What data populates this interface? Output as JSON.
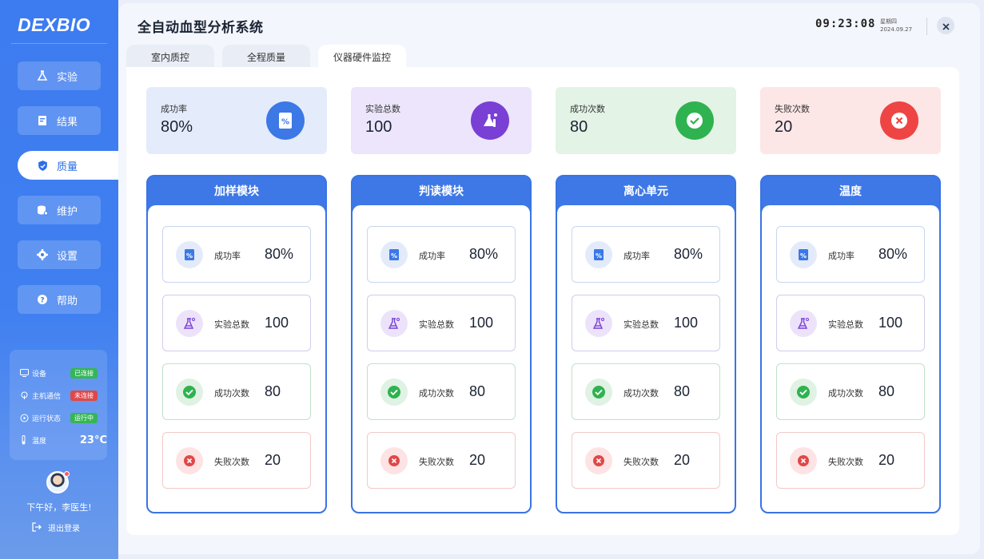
{
  "brand": "DEXBIO",
  "app_title": "全自动血型分析系统",
  "clock": {
    "time": "09:23:08",
    "weekday": "星期四",
    "date": "2024.09.27"
  },
  "nav": [
    {
      "label": "实验",
      "icon": "flask-icon"
    },
    {
      "label": "结果",
      "icon": "document-icon"
    },
    {
      "label": "质量",
      "icon": "shield-icon",
      "active": true
    },
    {
      "label": "维护",
      "icon": "database-icon"
    },
    {
      "label": "设置",
      "icon": "gear-icon"
    },
    {
      "label": "帮助",
      "icon": "help-icon"
    }
  ],
  "status": [
    {
      "label": "设备",
      "badge": "已连接",
      "badge_color": "#35b656",
      "icon": "monitor-icon"
    },
    {
      "label": "主机通信",
      "badge": "未连接",
      "badge_color": "#e04848",
      "icon": "antenna-icon"
    },
    {
      "label": "运行状态",
      "badge": "运行中",
      "badge_color": "#35b656",
      "icon": "running-icon"
    },
    {
      "label": "温度",
      "value": "23°C",
      "icon": "thermometer-icon"
    }
  ],
  "user": {
    "greeting": "下午好，李医生!",
    "logout": "退出登录"
  },
  "tabs": [
    {
      "label": "室内质控"
    },
    {
      "label": "全程质量"
    },
    {
      "label": "仪器硬件监控",
      "active": true
    }
  ],
  "summary": [
    {
      "label": "成功率",
      "value": "80%",
      "bg": "#e4ecfb",
      "icon_bg": "#3c78e6",
      "icon": "percent-icon"
    },
    {
      "label": "实验总数",
      "value": "100",
      "bg": "#ece5fb",
      "icon_bg": "#7a3fd4",
      "icon": "flask-icon"
    },
    {
      "label": "成功次数",
      "value": "80",
      "bg": "#e3f3e6",
      "icon_bg": "#2fb250",
      "icon": "check-icon"
    },
    {
      "label": "失败次数",
      "value": "20",
      "bg": "#fde6e6",
      "icon_bg": "#ef4444",
      "icon": "x-icon"
    }
  ],
  "modules": [
    {
      "title": "加样模块",
      "metrics": [
        {
          "label": "成功率",
          "value": "80%"
        },
        {
          "label": "实验总数",
          "value": "100"
        },
        {
          "label": "成功次数",
          "value": "80"
        },
        {
          "label": "失败次数",
          "value": "20"
        }
      ]
    },
    {
      "title": "判读模块",
      "metrics": [
        {
          "label": "成功率",
          "value": "80%"
        },
        {
          "label": "实验总数",
          "value": "100"
        },
        {
          "label": "成功次数",
          "value": "80"
        },
        {
          "label": "失败次数",
          "value": "20"
        }
      ]
    },
    {
      "title": "离心单元",
      "metrics": [
        {
          "label": "成功率",
          "value": "80%"
        },
        {
          "label": "实验总数",
          "value": "100"
        },
        {
          "label": "成功次数",
          "value": "80"
        },
        {
          "label": "失败次数",
          "value": "20"
        }
      ]
    },
    {
      "title": "温度",
      "metrics": [
        {
          "label": "成功率",
          "value": "80%"
        },
        {
          "label": "实验总数",
          "value": "100"
        },
        {
          "label": "成功次数",
          "value": "80"
        },
        {
          "label": "失败次数",
          "value": "20"
        }
      ]
    }
  ],
  "metric_styles": [
    {
      "icon": "percent-icon",
      "icon_bg": "#e3ebfb",
      "border": "#c9d6ee"
    },
    {
      "icon": "flask-icon",
      "icon_bg": "#ece3fb",
      "border": "#d4cbea"
    },
    {
      "icon": "check-icon",
      "icon_bg": "#dff2e3",
      "border": "#bfe2c6"
    },
    {
      "icon": "x-icon",
      "icon_bg": "#fde3e3",
      "border": "#f3c9c9"
    }
  ]
}
